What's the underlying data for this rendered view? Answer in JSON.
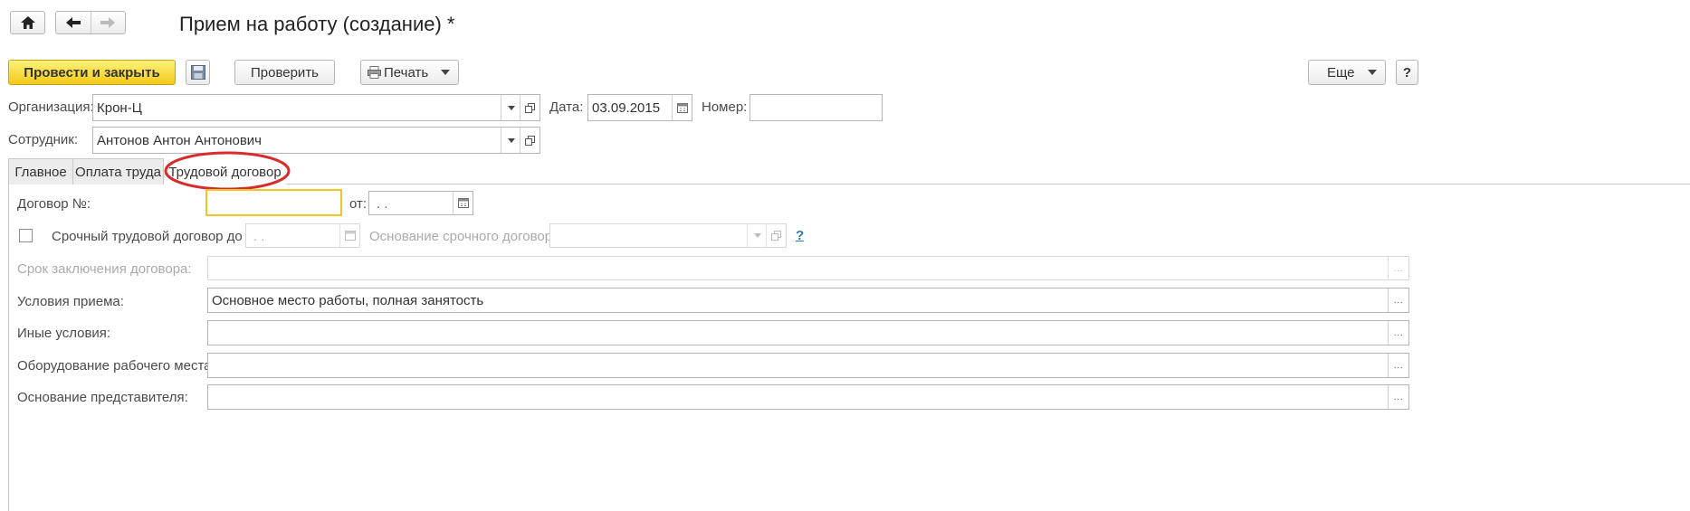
{
  "window": {
    "title": "Прием на работу (создание) *"
  },
  "toolbar": {
    "post_close_label": "Провести и закрыть",
    "check_label": "Проверить",
    "print_label": "Печать",
    "more_label": "Еще",
    "help_label": "?"
  },
  "form": {
    "organization": {
      "label": "Организация:",
      "value": "Крон-Ц"
    },
    "date": {
      "label": "Дата:",
      "value": "03.09.2015"
    },
    "number": {
      "label": "Номер:",
      "value": ""
    },
    "employee": {
      "label": "Сотрудник:",
      "value": "Антонов Антон Антонович"
    }
  },
  "tabs": [
    {
      "label": "Главное"
    },
    {
      "label": "Оплата труда"
    },
    {
      "label": "Трудовой договор"
    }
  ],
  "contract": {
    "number_label": "Договор №:",
    "number_value": "",
    "from_label": "от:",
    "from_value": " .  .",
    "fixed_term_label": "Срочный трудовой договор до",
    "fixed_term_date": " .  .",
    "fixed_term_reason_label": "Основание срочного договора:",
    "help_link": "?",
    "term_label": "Срок заключения договора:",
    "conditions_label": "Условия приема:",
    "conditions_value": "Основное место работы, полная занятость",
    "other_conditions_label": "Иные условия:",
    "workplace_equipment_label": "Оборудование рабочего места:",
    "representative_basis_label": "Основание представителя:",
    "select_button": "..."
  },
  "colors": {
    "primary_button": "#f5d12a",
    "annotation_ellipse": "#d92b2b",
    "focus_border": "#f4c327",
    "help_link": "#2a7ab8"
  },
  "icons": {
    "home": "home-icon",
    "back": "arrow-left-icon",
    "forward": "arrow-right-icon",
    "save": "floppy-disk-icon",
    "print": "printer-icon",
    "calendar": "calendar-icon",
    "open": "open-form-icon"
  }
}
